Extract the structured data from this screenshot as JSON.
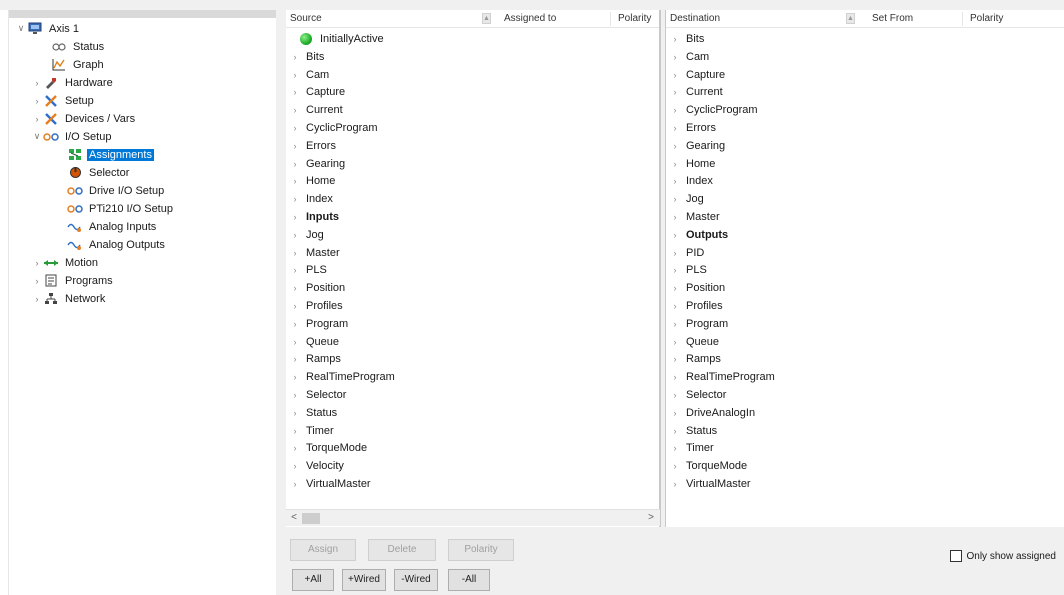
{
  "tree": {
    "items": [
      {
        "label": "Axis 1",
        "icon": "axis-icon",
        "chevron": "expanded"
      },
      {
        "label": "Status",
        "icon": "status-icon",
        "chevron": ""
      },
      {
        "label": "Graph",
        "icon": "graph-icon",
        "chevron": ""
      },
      {
        "label": "Hardware",
        "icon": "hardware-icon",
        "chevron": "collapsed"
      },
      {
        "label": "Setup",
        "icon": "setup-icon",
        "chevron": "collapsed"
      },
      {
        "label": "Devices / Vars",
        "icon": "devices-icon",
        "chevron": "collapsed"
      },
      {
        "label": "I/O Setup",
        "icon": "io-setup-icon",
        "chevron": "expanded"
      },
      {
        "label": "Assignments",
        "icon": "assignments-icon",
        "chevron": "",
        "selected": true
      },
      {
        "label": "Selector",
        "icon": "selector-icon",
        "chevron": ""
      },
      {
        "label": "Drive I/O Setup",
        "icon": "drive-io-icon",
        "chevron": ""
      },
      {
        "label": "PTi210 I/O Setup",
        "icon": "pti210-io-icon",
        "chevron": ""
      },
      {
        "label": "Analog Inputs",
        "icon": "analog-inputs-icon",
        "chevron": ""
      },
      {
        "label": "Analog Outputs",
        "icon": "analog-outputs-icon",
        "chevron": ""
      },
      {
        "label": "Motion",
        "icon": "motion-icon",
        "chevron": "collapsed"
      },
      {
        "label": "Programs",
        "icon": "programs-icon",
        "chevron": "collapsed"
      },
      {
        "label": "Network",
        "icon": "network-icon",
        "chevron": "collapsed"
      }
    ]
  },
  "source": {
    "headers": {
      "col1": "Source",
      "col2": "Assigned to",
      "col3": "Polarity"
    },
    "items": [
      {
        "label": "InitiallyActive",
        "type": "dot"
      },
      {
        "label": "Bits"
      },
      {
        "label": "Cam"
      },
      {
        "label": "Capture"
      },
      {
        "label": "Current"
      },
      {
        "label": "CyclicProgram"
      },
      {
        "label": "Errors"
      },
      {
        "label": "Gearing"
      },
      {
        "label": "Home"
      },
      {
        "label": "Index"
      },
      {
        "label": "Inputs",
        "bold": true
      },
      {
        "label": "Jog"
      },
      {
        "label": "Master"
      },
      {
        "label": "PLS"
      },
      {
        "label": "Position"
      },
      {
        "label": "Profiles"
      },
      {
        "label": "Program"
      },
      {
        "label": "Queue"
      },
      {
        "label": "Ramps"
      },
      {
        "label": "RealTimeProgram"
      },
      {
        "label": "Selector"
      },
      {
        "label": "Status"
      },
      {
        "label": "Timer"
      },
      {
        "label": "TorqueMode"
      },
      {
        "label": "Velocity"
      },
      {
        "label": "VirtualMaster"
      }
    ]
  },
  "destination": {
    "headers": {
      "col1": "Destination",
      "col2": "Set From",
      "col3": "Polarity"
    },
    "items": [
      {
        "label": "Bits"
      },
      {
        "label": "Cam"
      },
      {
        "label": "Capture"
      },
      {
        "label": "Current"
      },
      {
        "label": "CyclicProgram"
      },
      {
        "label": "Errors"
      },
      {
        "label": "Gearing"
      },
      {
        "label": "Home"
      },
      {
        "label": "Index"
      },
      {
        "label": "Jog"
      },
      {
        "label": "Master"
      },
      {
        "label": "Outputs",
        "bold": true
      },
      {
        "label": "PID"
      },
      {
        "label": "PLS"
      },
      {
        "label": "Position"
      },
      {
        "label": "Profiles"
      },
      {
        "label": "Program"
      },
      {
        "label": "Queue"
      },
      {
        "label": "Ramps"
      },
      {
        "label": "RealTimeProgram"
      },
      {
        "label": "Selector"
      },
      {
        "label": "DriveAnalogIn"
      },
      {
        "label": "Status"
      },
      {
        "label": "Timer"
      },
      {
        "label": "TorqueMode"
      },
      {
        "label": "VirtualMaster"
      }
    ]
  },
  "buttons": {
    "assign": "Assign",
    "delete": "Delete",
    "polarity": "Polarity",
    "plus_all": "+All",
    "plus_wired": "+Wired",
    "minus_wired": "-Wired",
    "minus_all": "-All"
  },
  "only_show_assigned": {
    "label": "Only show assigned",
    "checked": false
  },
  "scroll": {
    "left_arrow": "<",
    "right_arrow": ">"
  },
  "colors": {
    "selection": "#0078d7",
    "active_dot": "#1fae2a"
  }
}
